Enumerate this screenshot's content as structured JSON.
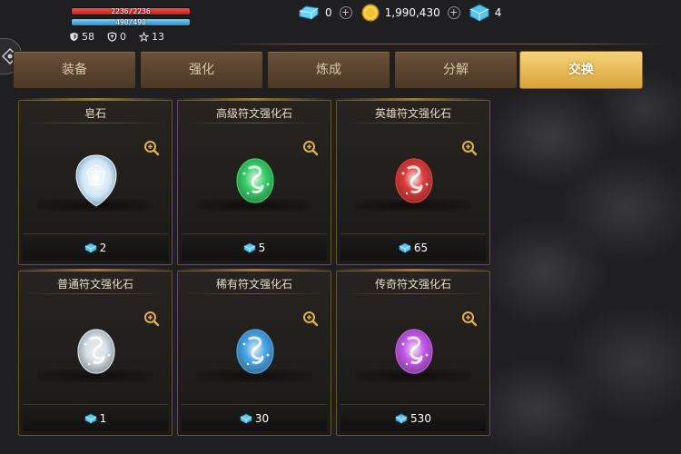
{
  "player": {
    "hp_text": "2236/2236",
    "hp_fill": 1.0,
    "mp_text": "490/490",
    "mp_fill": 1.0,
    "stat_1": "58",
    "stat_2": "0",
    "stat_3": "13"
  },
  "currencies": {
    "diamonds": "0",
    "gold": "1,990,430",
    "crystals": "4"
  },
  "tabs": [
    {
      "label": "装备",
      "active": false
    },
    {
      "label": "强化",
      "active": false
    },
    {
      "label": "炼成",
      "active": false
    },
    {
      "label": "分解",
      "active": false
    },
    {
      "label": "交换",
      "active": true
    }
  ],
  "items": [
    {
      "name": "皂石",
      "price": "2",
      "color": "#cfe6f5"
    },
    {
      "name": "高级符文强化石",
      "price": "5",
      "color": "#37d46a"
    },
    {
      "name": "英雄符文强化石",
      "price": "65",
      "color": "#e23b3b"
    },
    {
      "name": "普通符文强化石",
      "price": "1",
      "color": "#d8e4ea"
    },
    {
      "name": "稀有符文强化石",
      "price": "30",
      "color": "#4aa8ee"
    },
    {
      "name": "传奇符文强化石",
      "price": "530",
      "color": "#c85af0"
    }
  ],
  "icons": {
    "shield": "shield-icon",
    "armor": "armor-icon",
    "star": "star-icon",
    "diamond": "diamond-icon",
    "gold": "gold-coin-icon",
    "crystal": "crystal-icon",
    "zoom": "zoom-in-icon"
  },
  "colors": {
    "tab_active": "#e3b24a",
    "tab_inactive": "#5a432e",
    "card_border": "#6b5233",
    "currency_blue": "#5ec8f2"
  }
}
